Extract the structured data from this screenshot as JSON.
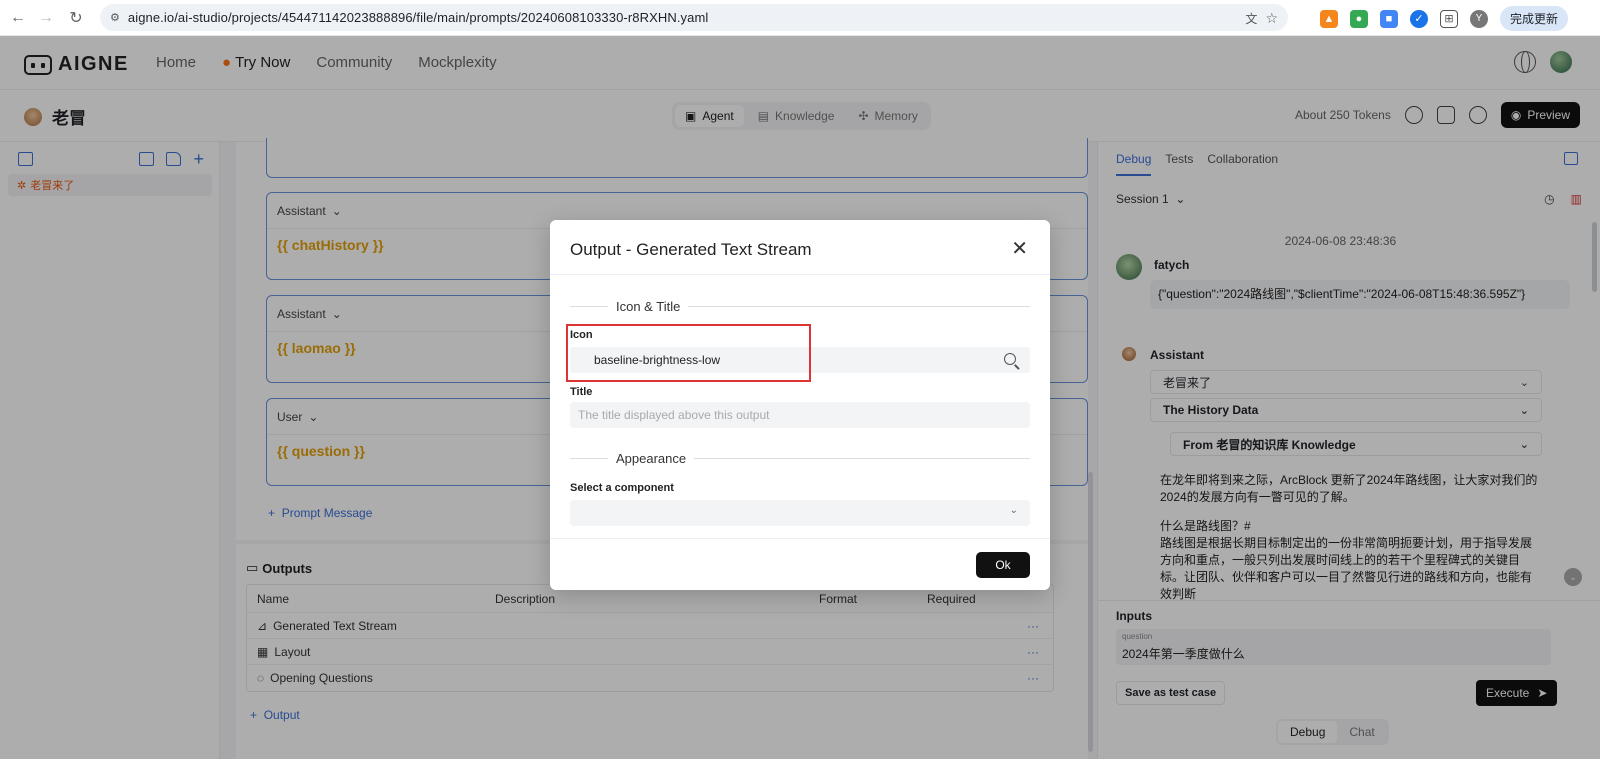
{
  "browser": {
    "url": "aigne.io/ai-studio/projects/454471142023888896/file/main/prompts/20240608103330-r8RXHN.yaml",
    "update_label": "完成更新",
    "profile_initial": "Y"
  },
  "header": {
    "logo_text": "AIGNE",
    "nav": [
      "Home",
      "Try Now",
      "Community",
      "Mockplexity"
    ]
  },
  "project": {
    "name": "老冒",
    "tabs": [
      "Agent",
      "Knowledge",
      "Memory"
    ],
    "tokens": "About 250 Tokens",
    "preview_label": "Preview"
  },
  "sidebar": {
    "file_label": "老冒来了"
  },
  "editor": {
    "messages": [
      {
        "role": "Assistant",
        "content": "{{ chatHistory }}"
      },
      {
        "role": "Assistant",
        "content": "{{ laomao }}"
      },
      {
        "role": "User",
        "content": "{{ question }}"
      }
    ],
    "add_prompt_label": "Prompt Message",
    "outputs_title": "Outputs",
    "outputs_columns": [
      "Name",
      "Description",
      "Format",
      "Required"
    ],
    "outputs_rows": [
      "Generated Text Stream",
      "Layout",
      "Opening Questions"
    ],
    "add_output_label": "Output"
  },
  "right_panel": {
    "tabs": [
      "Debug",
      "Tests",
      "Collaboration"
    ],
    "session": "Session 1",
    "timestamp": "2024-06-08 23:48:36",
    "user_name": "fatych",
    "user_message": "{\"question\":\"2024路线图\",\"$clientTime\":\"2024-06-08T15:48:36.595Z\"}",
    "assistant_name": "Assistant",
    "accordions": [
      "老冒来了",
      "The History Data",
      "From 老冒的知识库 Knowledge"
    ],
    "answer_p1": "在龙年即将到来之际，ArcBlock 更新了2024年路线图，让大家对我们的2024的发展方向有一瞥可见的了解。",
    "answer_p2": "什么是路线图？#",
    "answer_p3": "路线图是根据长期目标制定出的一份非常简明扼要计划，用于指导发展方向和重点，一般只列出发展时间线上的的若干个里程碑式的关键目标。让团队、伙伴和客户可以一目了然瞥见行进的路线和方向，也能有效判断",
    "inputs_title": "Inputs",
    "question_label": "question",
    "question_value": "2024年第一季度做什么",
    "save_test_label": "Save as test case",
    "execute_label": "Execute",
    "mode_tabs": [
      "Debug",
      "Chat"
    ]
  },
  "modal": {
    "title": "Output - Generated Text Stream",
    "section1": "Icon & Title",
    "icon_label": "Icon",
    "icon_value": "baseline-brightness-low",
    "title_label": "Title",
    "title_placeholder": "The title displayed above this output",
    "section2": "Appearance",
    "component_label": "Select a component",
    "ok_label": "Ok"
  },
  "colors": {
    "accent": "#3b6fd6",
    "highlight": "#dd3333",
    "variable": "#e3a008"
  }
}
